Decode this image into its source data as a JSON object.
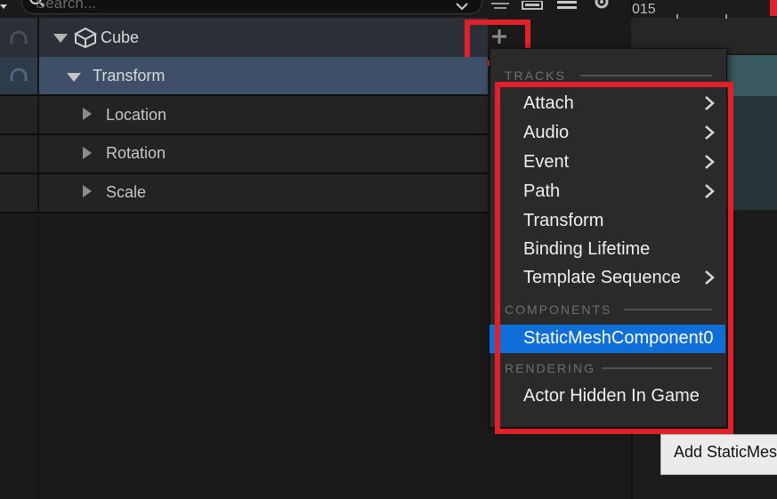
{
  "toolbar": {
    "search_placeholder": "Search...",
    "timecode": "015"
  },
  "tree": {
    "actor": "Cube",
    "transform": "Transform",
    "tracks": [
      "Location",
      "Rotation",
      "Scale"
    ]
  },
  "menu": {
    "section_tracks": "TRACKS",
    "items": [
      {
        "label": "Attach",
        "submenu": true
      },
      {
        "label": "Audio",
        "submenu": true
      },
      {
        "label": "Event",
        "submenu": true
      },
      {
        "label": "Path",
        "submenu": true
      },
      {
        "label": "Transform",
        "submenu": false
      },
      {
        "label": "Binding Lifetime",
        "submenu": false
      },
      {
        "label": "Template Sequence",
        "submenu": true
      }
    ],
    "section_components": "COMPONENTS",
    "component_item": "StaticMeshComponent0",
    "section_rendering": "RENDERING",
    "rendering_item": "Actor Hidden In Game"
  },
  "tooltip": {
    "text": "Add StaticMes"
  },
  "colors": {
    "selected": "#0e6fd8",
    "annotation": "#e3202a",
    "transform_row": "#3d5067"
  }
}
